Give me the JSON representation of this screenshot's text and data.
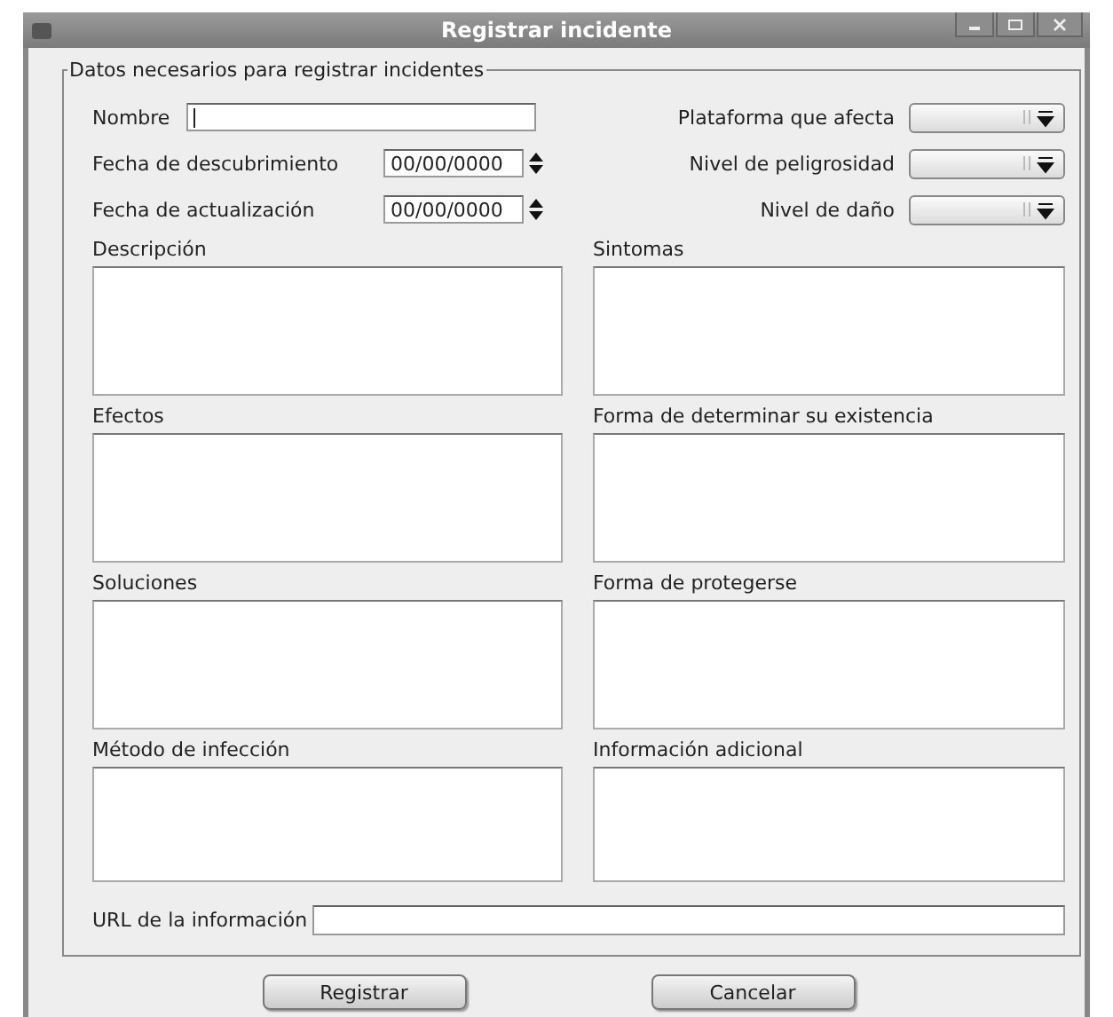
{
  "window": {
    "title": "Registrar incidente"
  },
  "group": {
    "title": "Datos necesarios para registrar incidentes"
  },
  "name_field": {
    "label": "Nombre"
  },
  "date_fields": [
    {
      "label": "Fecha de descubrimiento",
      "value": "00/00/0000"
    },
    {
      "label": "Fecha de actualización",
      "value": "00/00/0000"
    }
  ],
  "dropdowns": [
    {
      "label": "Plataforma que afecta"
    },
    {
      "label": "Nivel de peligrosidad"
    },
    {
      "label": "Nivel de daño"
    }
  ],
  "text_areas": [
    {
      "label": "Descripción"
    },
    {
      "label": "Sintomas"
    },
    {
      "label": "Efectos"
    },
    {
      "label": "Forma de determinar su existencia"
    },
    {
      "label": "Soluciones"
    },
    {
      "label": "Forma de protegerse"
    },
    {
      "label": "Método de infección"
    },
    {
      "label": "Información adicional"
    }
  ],
  "url_field": {
    "label": "URL de la información"
  },
  "buttons": [
    "Registrar",
    "Cancelar"
  ]
}
